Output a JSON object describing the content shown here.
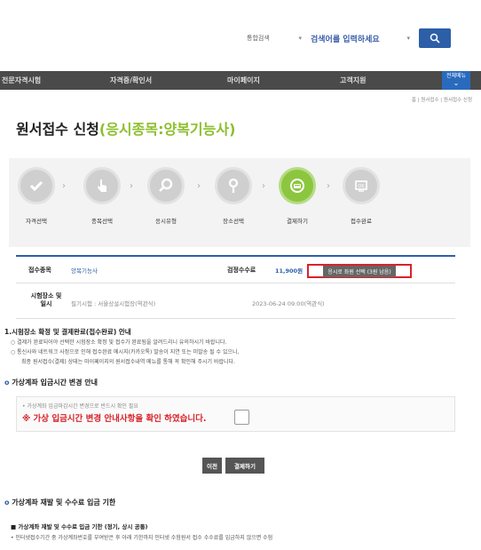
{
  "search": {
    "scope": "통합검색",
    "placeholder": "검색어를 입력하세요"
  },
  "nav": {
    "items": [
      "전문자격시험",
      "자격증/확인서",
      "마이페이지",
      "고객지원"
    ],
    "all_menu": "전체메뉴"
  },
  "breadcrumb": "홈 | 원서접수 | 원서접수 신청",
  "page_title": {
    "prefix": "원서접수 신청",
    "accent": "(응시종목:양복기능사)"
  },
  "steps": [
    {
      "label": "자격선택",
      "icon": "check-icon",
      "active": false
    },
    {
      "label": "종목선택",
      "icon": "pointer-icon",
      "active": false
    },
    {
      "label": "응시유형",
      "icon": "search-icon",
      "active": false
    },
    {
      "label": "장소선택",
      "icon": "location-pin-icon",
      "active": false
    },
    {
      "label": "결제하기",
      "icon": "payment-icon",
      "active": true
    },
    {
      "label": "접수완료",
      "icon": "ok-icon",
      "active": false
    }
  ],
  "info": {
    "item_label": "접수종목",
    "item_value": "양복기능사",
    "fee_label": "검정수수료",
    "fee_value": "11,900원",
    "seat_button": "응시로 좌원 선택 (3원 남음)",
    "place_label": "시험장소 및 일시",
    "place_value": "필기시험 : 서울상설시험장(역관식)",
    "date_value": "2023-06-24 09:00(역관식)"
  },
  "notice": {
    "title": "1.시험장소 확정 및 결제완료(접수완료) 안내",
    "lines": [
      "○ 결제가 완료되어야 선택한 시험장소 확정 및 접수가 완료됨을 알려드리니 유의하시기 바랍니다.",
      "○ 통신사와 네트워크 사정으로 인해 접수완료 메시지(카카오톡) 발송이 지연 또는 미발송 될 수 있으니,",
      "최종 원서접수(결제) 상태는 마이페이지의 원서접수내역 메뉴를 통해 꼭 확인해 주시기 바랍니다."
    ]
  },
  "virtual_account": {
    "section_title": "가상계좌 입금시간 변경 안내",
    "small": "• 가상계좌 입금마감시간 변경으로 반드시 확인 필요",
    "big": "※ 가상 입금시간 변경 안내사항을 확인 하였습니다."
  },
  "buttons": {
    "prev": "이전",
    "pay": "결제하기"
  },
  "deadline": {
    "section_title": "가상계좌 재발 및 수수료 입금 기한",
    "sub_title": "■ 가상계좌 재발 및 수수료 입금 기한 (정기, 상시 공통)",
    "line": "• 인터넷접수기간 중 가상계좌번호를 부여받은 후 아래 기한까지 인터넷 수험원서 접수 수수료를 입금하지 않으면 수험"
  }
}
